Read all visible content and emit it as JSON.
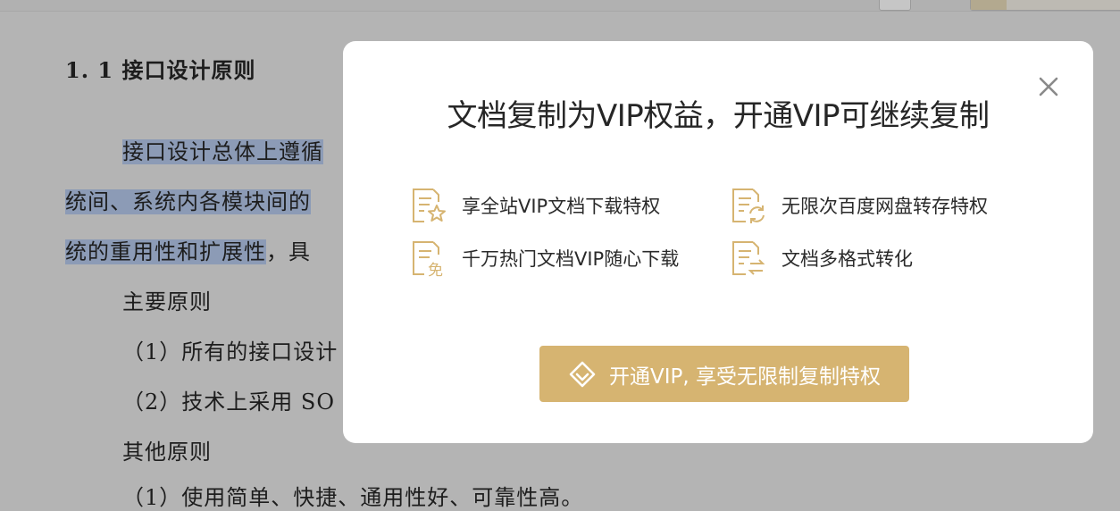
{
  "document": {
    "heading": "1. 1 接口设计原则",
    "lines": [
      "接口设计总体上遵循",
      "统间、系统内各模块间的",
      "统的重用性和扩展性",
      "，具",
      "主要原则",
      "（1）所有的接口设计",
      "（2）技术上采用 SO",
      "其他原则",
      "（1）使用简单、快捷、通用性好、可靠性高。"
    ]
  },
  "modal": {
    "title": "文档复制为VIP权益，开通VIP可继续复制",
    "features": [
      {
        "icon": "doc-star-icon",
        "label": "享全站VIP文档下载特权"
      },
      {
        "icon": "doc-refresh-icon",
        "label": "无限次百度网盘转存特权"
      },
      {
        "icon": "doc-free-icon",
        "label": "千万热门文档VIP随心下载",
        "icon_text": "免"
      },
      {
        "icon": "doc-convert-icon",
        "label": "文档多格式转化"
      }
    ],
    "cta_label": "开通VIP, 享受无限制复制特权",
    "close_icon": "close-icon"
  },
  "colors": {
    "accent": "#d6b471",
    "highlight": "#8c9bb6",
    "overlay": "#b4b4b4"
  }
}
